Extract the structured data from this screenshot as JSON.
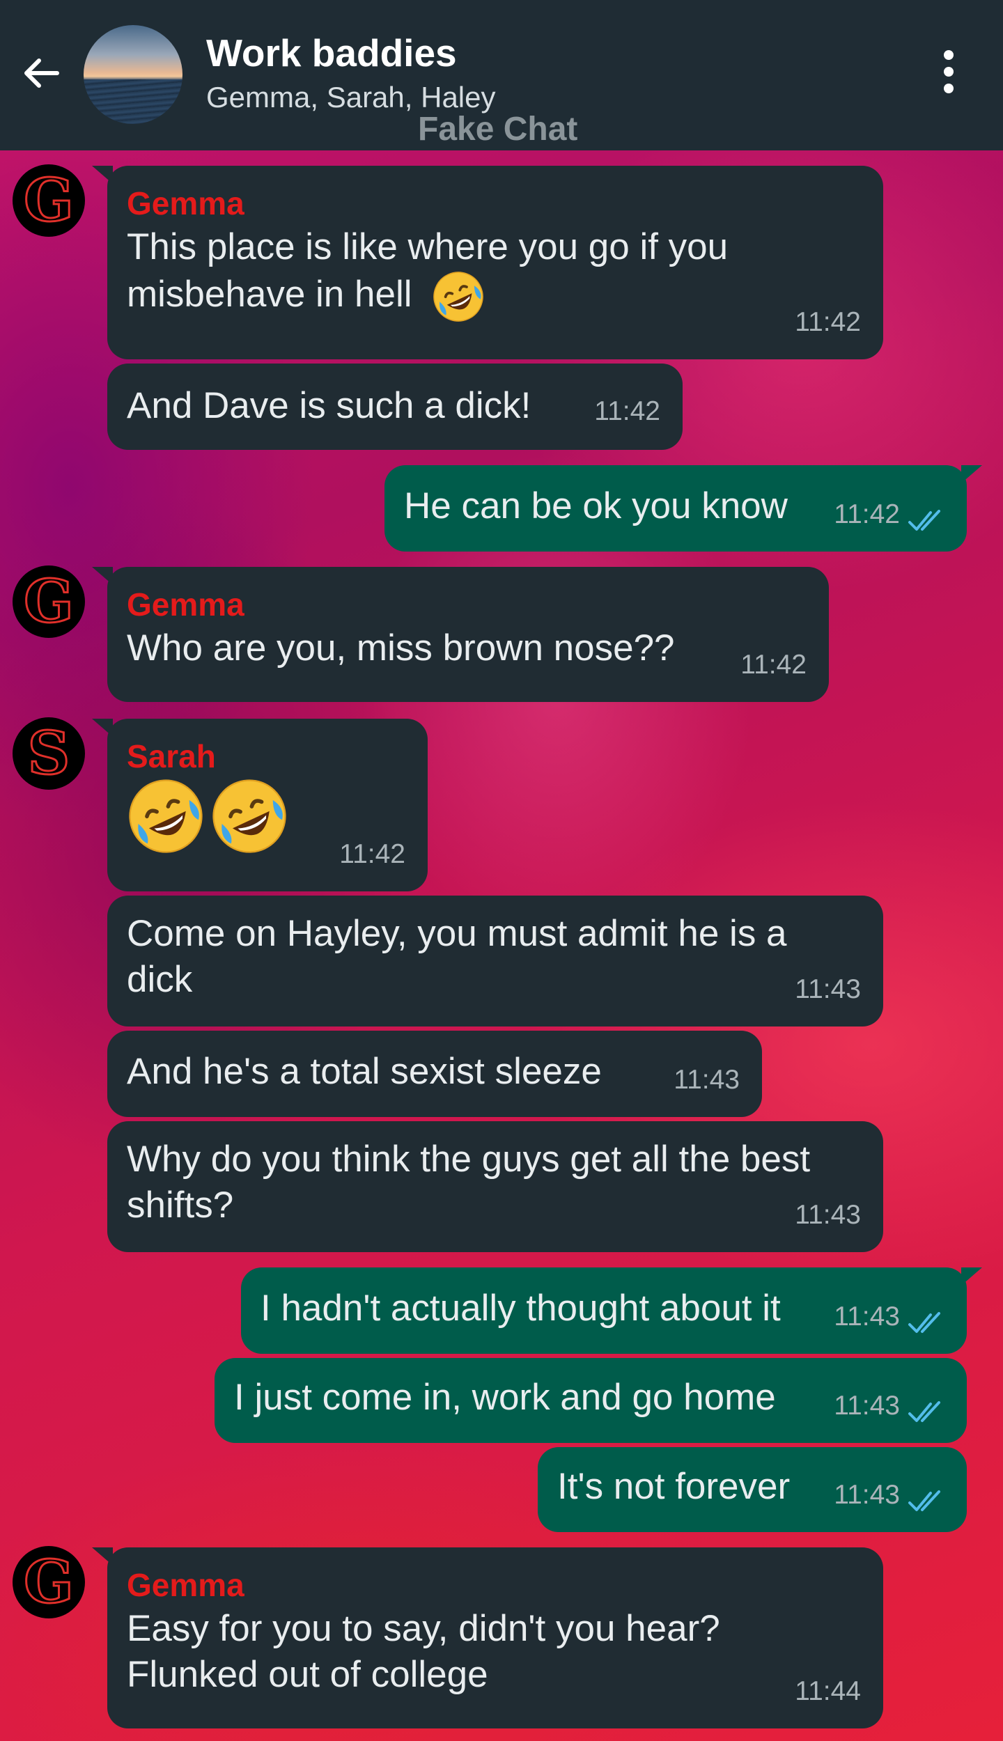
{
  "header": {
    "title": "Work baddies",
    "participants": "Gemma, Sarah, Haley",
    "watermark": "Fake Chat"
  },
  "colors": {
    "header_bg": "#1f2c34",
    "incoming_bubble": "#202c33",
    "outgoing_bubble": "#005c4b",
    "sender_name": "#e41b1b",
    "read_ticks": "#53bdeb"
  },
  "avatars": {
    "gemma": "G",
    "sarah": "S"
  },
  "messages": [
    {
      "sender": "Gemma",
      "text": "This place is like where you go if you\nmisbehave in hell",
      "emoji": "rolling-on-floor-laughing",
      "time": "11:42"
    },
    {
      "text": "And Dave is such a dick!",
      "time": "11:42"
    },
    {
      "text": "He can be ok you know",
      "time": "11:42",
      "status": "read"
    },
    {
      "sender": "Gemma",
      "text": "Who are you, miss brown nose??",
      "time": "11:42"
    },
    {
      "sender": "Sarah",
      "emoji": "rolling-on-floor-laughing x2",
      "time": "11:42"
    },
    {
      "text": "Come on Hayley, you must admit he is a\ndick",
      "time": "11:43"
    },
    {
      "text": "And he's a total sexist sleeze",
      "time": "11:43"
    },
    {
      "text": "Why do you think the guys get all the best\nshifts?",
      "time": "11:43"
    },
    {
      "text": "I hadn't actually thought about it",
      "time": "11:43",
      "status": "read"
    },
    {
      "text": "I just come in, work and go home",
      "time": "11:43",
      "status": "read"
    },
    {
      "text": "It's not forever",
      "time": "11:43",
      "status": "read"
    },
    {
      "sender": "Gemma",
      "text": "Easy for you to say, didn't you hear?\nFlunked out of college",
      "time": "11:44"
    }
  ]
}
